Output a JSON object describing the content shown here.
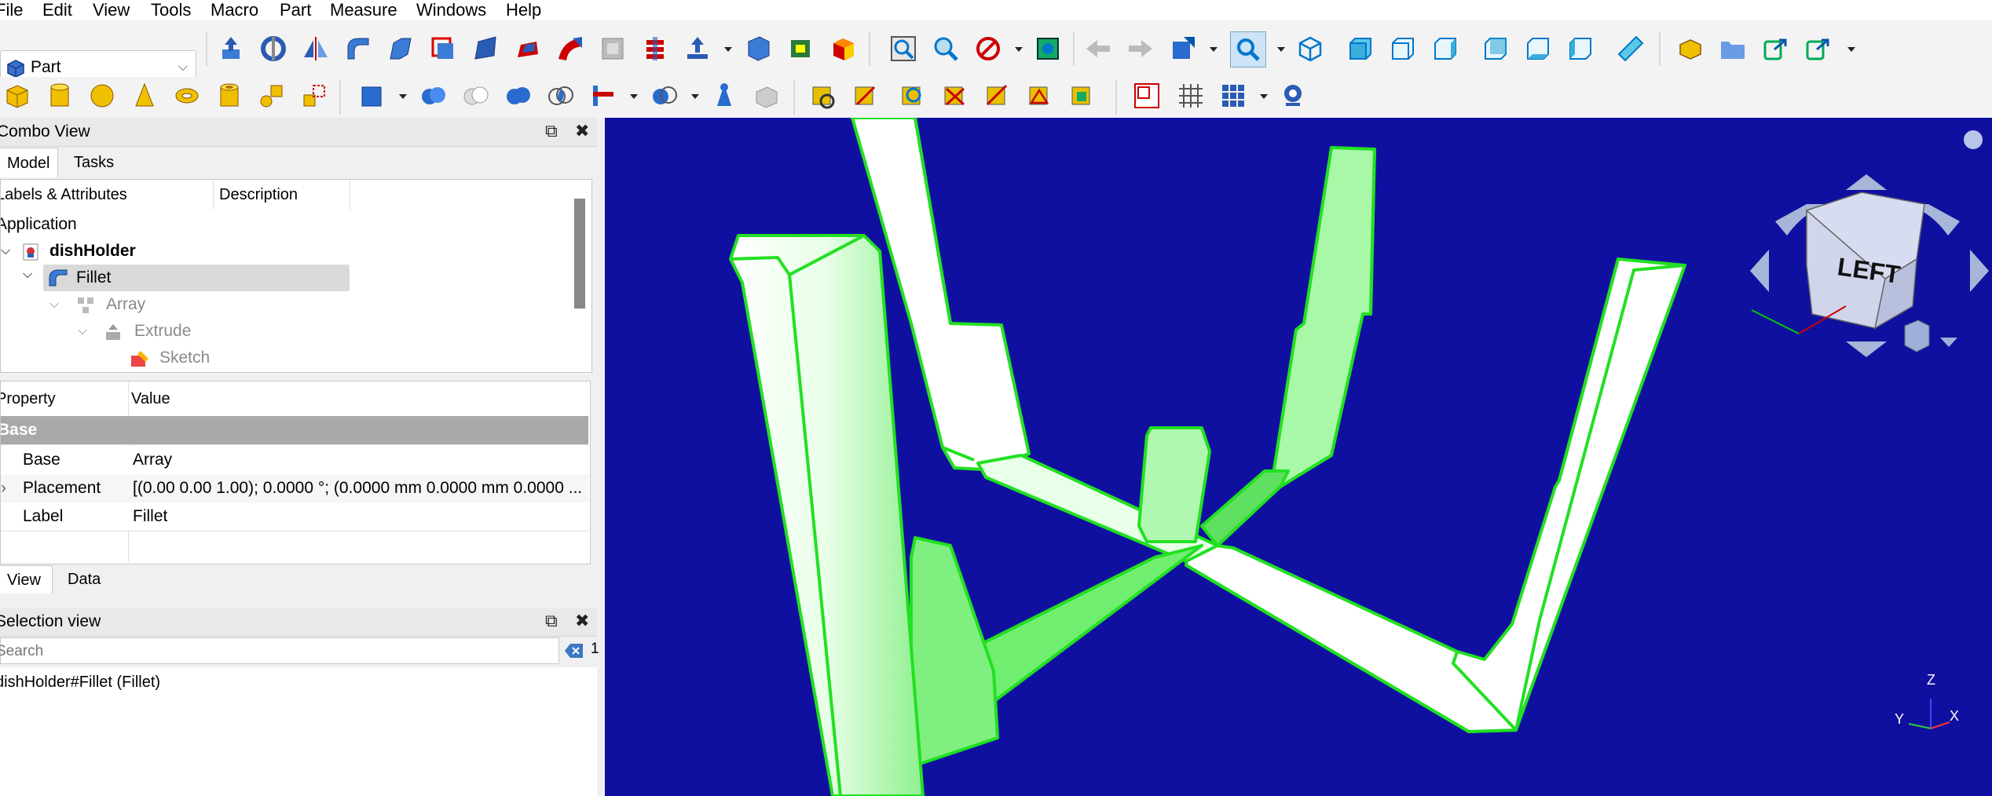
{
  "menu": [
    "File",
    "Edit",
    "View",
    "Tools",
    "Macro",
    "Part",
    "Measure",
    "Windows",
    "Help"
  ],
  "workbench": {
    "label": "Part"
  },
  "combo_view": {
    "title": "Combo View",
    "tabs": [
      "Model",
      "Tasks"
    ],
    "tree_headers": [
      "Labels & Attributes",
      "Description"
    ],
    "tree": [
      {
        "label": "Application"
      },
      {
        "label": "dishHolder"
      },
      {
        "label": "Fillet"
      },
      {
        "label": "Array"
      },
      {
        "label": "Extrude"
      },
      {
        "label": "Sketch"
      }
    ],
    "prop_headers": [
      "Property",
      "Value"
    ],
    "group": "Base",
    "props": [
      {
        "name": "Base",
        "value": "Array"
      },
      {
        "name": "Placement",
        "value": "[(0.00 0.00 1.00); 0.0000 °; (0.0000 mm  0.0000 mm  0.0000 ..."
      },
      {
        "name": "Label",
        "value": "Fillet"
      }
    ],
    "bottom_tabs": [
      "View",
      "Data"
    ]
  },
  "selection_view": {
    "title": "Selection view",
    "search_placeholder": "Search",
    "count": "1",
    "item": "dishHolder#Fillet (Fillet)"
  },
  "navcube": {
    "face": "LEFT"
  },
  "axes": {
    "z": "Z",
    "y": "Y",
    "x": "X"
  },
  "colors": {
    "viewport": "#1010a0",
    "model_fill": "#80f080",
    "model_edge": "#20e020",
    "selection": "#d9d9d9"
  }
}
